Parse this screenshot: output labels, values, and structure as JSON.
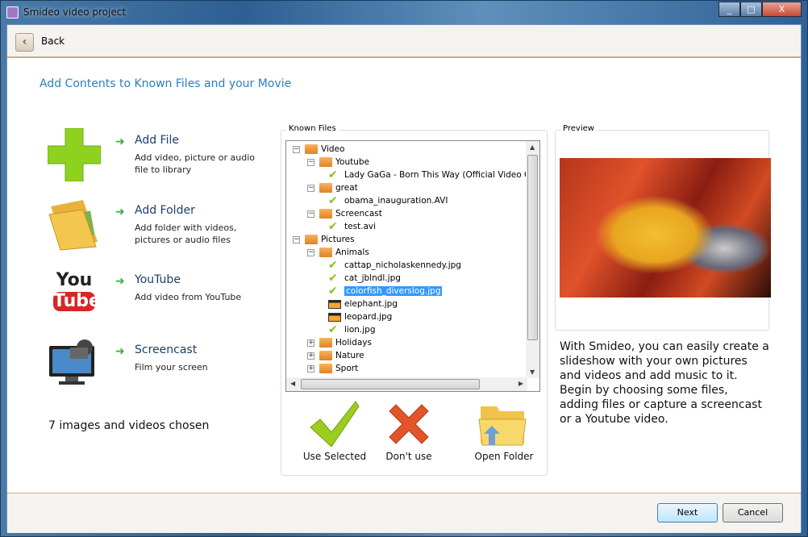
{
  "window": {
    "title": "Smideo video project",
    "minimize": "_",
    "maximize": "□",
    "close": "X"
  },
  "nav": {
    "back_label": "Back"
  },
  "heading": "Add Contents to Known Files and your Movie",
  "actions": [
    {
      "label": "Add File",
      "desc1": "Add video, picture or audio",
      "desc2": "file to library"
    },
    {
      "label": "Add Folder",
      "desc1": "Add folder with videos,",
      "desc2": "pictures or audio files"
    },
    {
      "label": "YouTube",
      "desc1": "Add video from YouTube",
      "desc2": ""
    },
    {
      "label": "Screencast",
      "desc1": "Film your screen",
      "desc2": ""
    }
  ],
  "youtube_logo": "You Tube",
  "chosen_count": "7 images and videos chosen",
  "known_files": {
    "label": "Known Files",
    "tree": [
      {
        "text": "Video",
        "level": 0,
        "type": "folder",
        "exp": "−"
      },
      {
        "text": "Youtube",
        "level": 1,
        "type": "folder",
        "exp": "−"
      },
      {
        "text": "Lady GaGa - Born This Way (Official Video Cle",
        "level": 2,
        "type": "checked"
      },
      {
        "text": "great",
        "level": 1,
        "type": "folder",
        "exp": "−"
      },
      {
        "text": "obama_inauguration.AVI",
        "level": 2,
        "type": "checked"
      },
      {
        "text": "Screencast",
        "level": 1,
        "type": "folder",
        "exp": "−"
      },
      {
        "text": "test.avi",
        "level": 2,
        "type": "checked"
      },
      {
        "text": "Pictures",
        "level": 0,
        "type": "folder",
        "exp": "−"
      },
      {
        "text": "Animals",
        "level": 1,
        "type": "folder",
        "exp": "−"
      },
      {
        "text": "cattap_nicholaskennedy.jpg",
        "level": 2,
        "type": "checked"
      },
      {
        "text": "cat_jblndl.jpg",
        "level": 2,
        "type": "checked"
      },
      {
        "text": "colorfish_diverslog.jpg",
        "level": 2,
        "type": "checked",
        "selected": true
      },
      {
        "text": "elephant.jpg",
        "level": 2,
        "type": "image"
      },
      {
        "text": "leopard.jpg",
        "level": 2,
        "type": "image"
      },
      {
        "text": "lion.jpg",
        "level": 2,
        "type": "checked"
      },
      {
        "text": "Holidays",
        "level": 1,
        "type": "folder",
        "exp": "+"
      },
      {
        "text": "Nature",
        "level": 1,
        "type": "folder",
        "exp": "+"
      },
      {
        "text": "Sport",
        "level": 1,
        "type": "folder",
        "exp": "+"
      }
    ],
    "use_selected": "Use Selected",
    "dont_use": "Don't use",
    "open_folder": "Open Folder"
  },
  "preview": {
    "label": "Preview",
    "text": "With Smideo, you can easily create a slideshow with your own pictures and videos and add music to it. Begin by choosing some files, adding files or capture a screencast or a Youtube video."
  },
  "footer": {
    "next": "Next",
    "cancel": "Cancel"
  },
  "colors": {
    "accent": "#2c7fc0",
    "selection": "#3399ff",
    "check": "#8cbf1a"
  }
}
